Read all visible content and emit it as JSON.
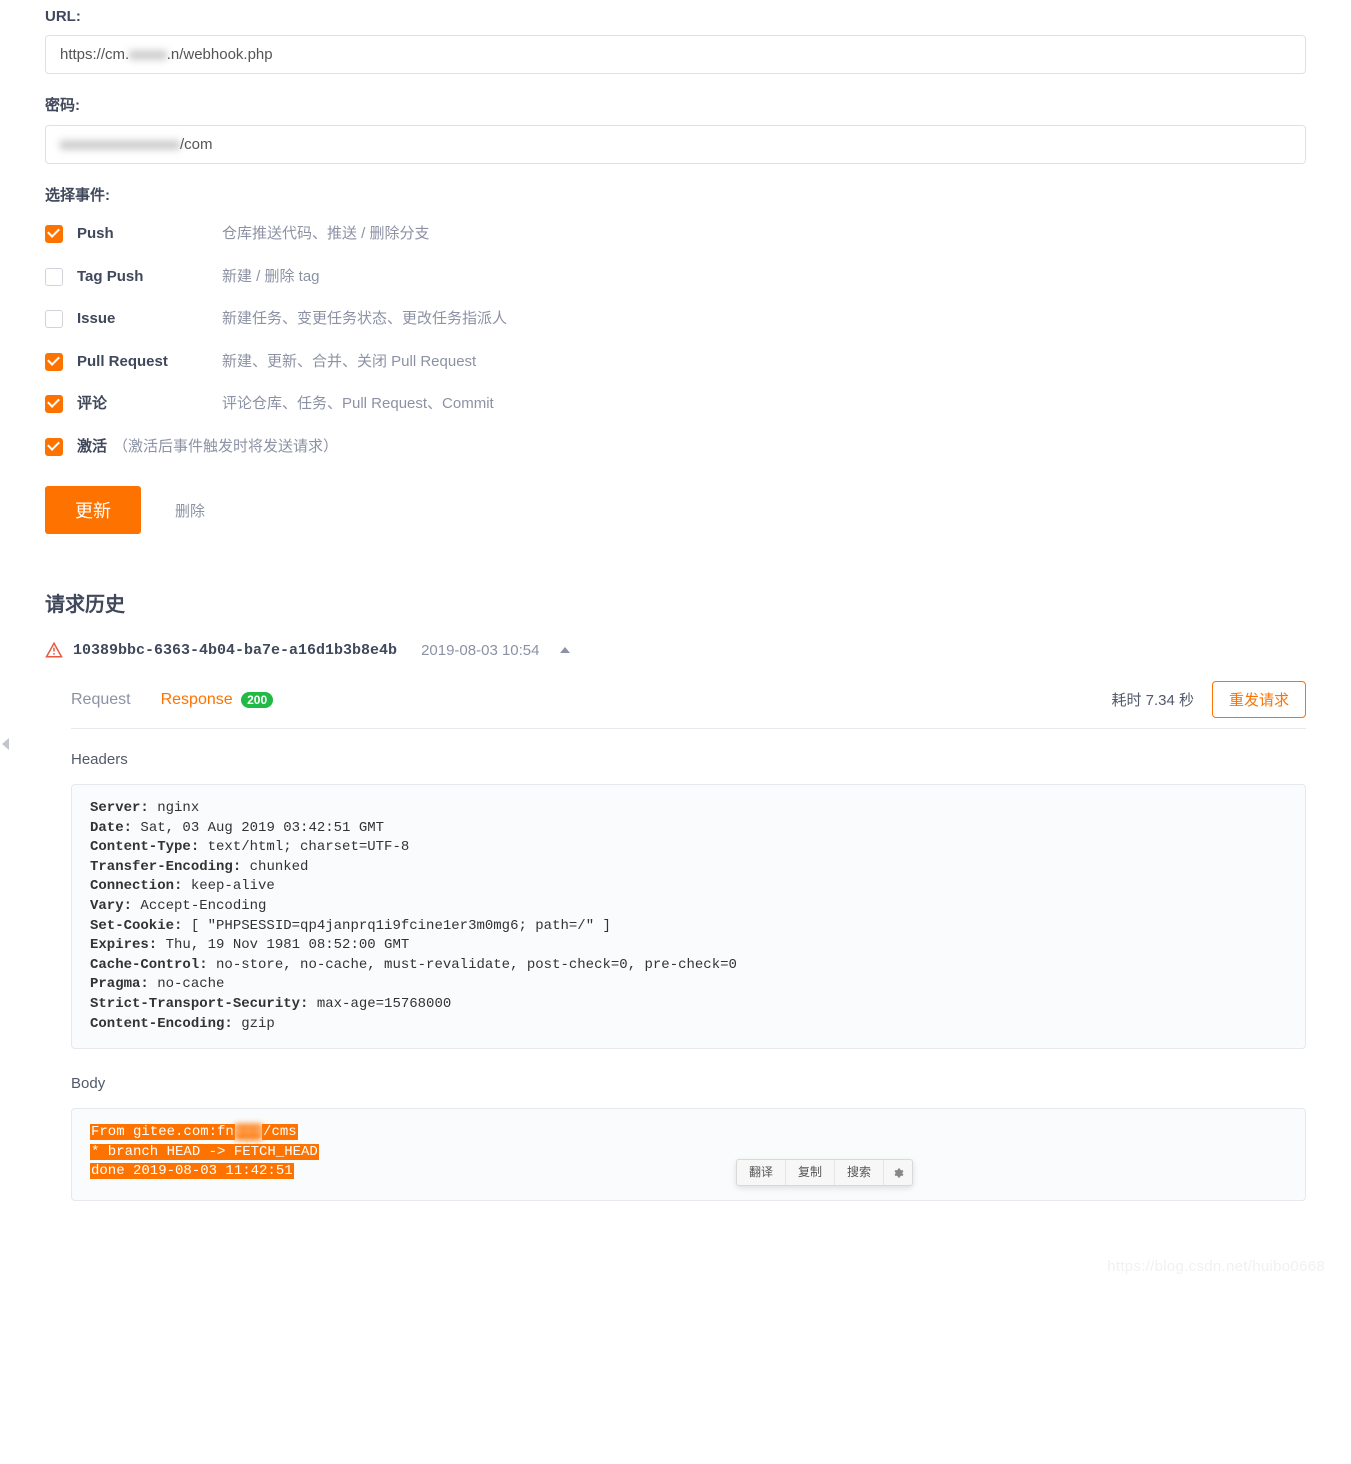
{
  "form": {
    "url_label": "URL:",
    "url_value_pre": "https://cm.",
    "url_value_blur": "xxxxx",
    "url_value_post": ".n/webhook.php",
    "password_label": "密码:",
    "password_blur": "xxxxxxxxxxxxxxxx",
    "password_post": "/com",
    "events_label": "选择事件:",
    "events": [
      {
        "checked": true,
        "name": "Push",
        "desc": "仓库推送代码、推送 / 删除分支"
      },
      {
        "checked": false,
        "name": "Tag Push",
        "desc": "新建 / 删除 tag"
      },
      {
        "checked": false,
        "name": "Issue",
        "desc": "新建任务、变更任务状态、更改任务指派人"
      },
      {
        "checked": true,
        "name": "Pull Request",
        "desc": "新建、更新、合并、关闭 Pull Request"
      },
      {
        "checked": true,
        "name": "评论",
        "desc": "评论仓库、任务、Pull Request、Commit"
      }
    ],
    "activate_label": "激活",
    "activate_hint": "（激活后事件触发时将发送请求）",
    "update_btn": "更新",
    "delete_btn": "删除"
  },
  "history": {
    "title": "请求历史",
    "request_id": "10389bbc-6363-4b04-ba7e-a16d1b3b8e4b",
    "time": "2019-08-03 10:54",
    "tabs": {
      "request": "Request",
      "response": "Response",
      "status": "200"
    },
    "elapsed": "耗时 7.34 秒",
    "resend": "重发请求",
    "headers_label": "Headers",
    "headers": [
      [
        "Server:",
        " nginx"
      ],
      [
        "Date:",
        " Sat, 03 Aug 2019 03:42:51 GMT"
      ],
      [
        "Content-Type:",
        " text/html; charset=UTF-8"
      ],
      [
        "Transfer-Encoding:",
        " chunked"
      ],
      [
        "Connection:",
        " keep-alive"
      ],
      [
        "Vary:",
        " Accept-Encoding"
      ],
      [
        "Set-Cookie:",
        " [ \"PHPSESSID=qp4janprq1i9fcine1er3m0mg6; path=/\" ]"
      ],
      [
        "Expires:",
        " Thu, 19 Nov 1981 08:52:00 GMT"
      ],
      [
        "Cache-Control:",
        " no-store, no-cache, must-revalidate, post-check=0, pre-check=0"
      ],
      [
        "Pragma:",
        " no-cache"
      ],
      [
        "Strict-Transport-Security:",
        " max-age=15768000"
      ],
      [
        "Content-Encoding:",
        " gzip"
      ]
    ],
    "body_label": "Body",
    "body": {
      "l1a": "From gitee.com:fn",
      "l1blur": "xxx",
      "l1b": "/cms",
      "l2": " * branch            HEAD       -> FETCH_HEAD",
      "l3": "done 2019-08-03 11:42:51"
    }
  },
  "ctx": {
    "translate": "翻译",
    "copy": "复制",
    "search": "搜索"
  },
  "watermark": "https://blog.csdn.net/huibo0668"
}
